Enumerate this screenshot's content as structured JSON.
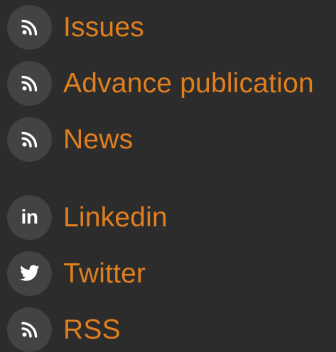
{
  "colors": {
    "background": "#2c2c2c",
    "icon_circle": "#434343",
    "icon_glyph": "#ffffff",
    "link_text": "#e07f1e"
  },
  "links": [
    {
      "label": "Issues",
      "icon": "rss-icon"
    },
    {
      "label": "Advance publication",
      "icon": "rss-icon"
    },
    {
      "label": "News",
      "icon": "rss-icon"
    }
  ],
  "social": [
    {
      "label": "Linkedin",
      "icon": "linkedin-icon",
      "icon_text": "in"
    },
    {
      "label": "Twitter",
      "icon": "twitter-icon"
    },
    {
      "label": "RSS",
      "icon": "rss-icon"
    }
  ]
}
